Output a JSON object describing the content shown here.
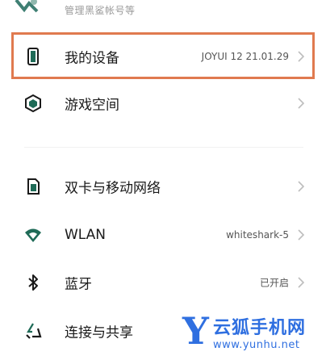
{
  "account": {
    "subtitle": "管理黑鲨帐号等"
  },
  "rows": [
    {
      "label": "我的设备",
      "value": "JOYUI 12 21.01.29",
      "icon": "phone-device-icon"
    },
    {
      "label": "游戏空间",
      "value": "",
      "icon": "game-space-icon"
    },
    {
      "label": "双卡与移动网络",
      "value": "",
      "icon": "sim-card-icon"
    },
    {
      "label": "WLAN",
      "value": "whiteshark-5",
      "icon": "wifi-icon"
    },
    {
      "label": "蓝牙",
      "value": "已开启",
      "icon": "bluetooth-icon"
    },
    {
      "label": "连接与共享",
      "value": "",
      "icon": "share-connection-icon"
    }
  ],
  "watermark": {
    "mark": "Y",
    "name": "云狐手机网",
    "url": "www.yunhu.net"
  },
  "colors": {
    "highlight": "#e07a4f",
    "icon_green": "#1f6b57",
    "watermark": "#2f6fe0"
  }
}
